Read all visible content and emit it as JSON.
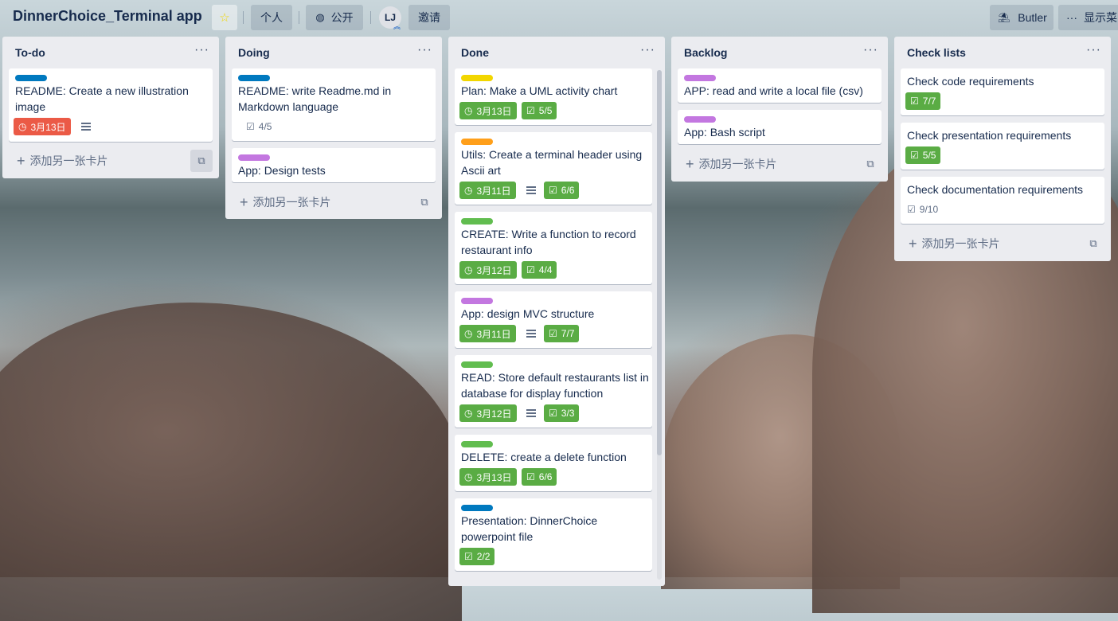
{
  "header": {
    "board_title": "DinnerChoice_Terminal app",
    "personal_label": "个人",
    "visibility_label": "公开",
    "avatar_initials": "LJ",
    "invite_label": "邀请",
    "butler_label": "Butler",
    "show_menu_label": "显示菜"
  },
  "add_card_label": "添加另一张卡片",
  "colors": {
    "label_blue": "#0079bf",
    "label_purple": "#c377e0",
    "label_yellow": "#f2d600",
    "label_orange": "#ff9f1a",
    "label_green": "#61bd4f",
    "badge_green": "#5aac44",
    "badge_red": "#eb5a46"
  },
  "lists": [
    {
      "title": "To-do",
      "cards": [
        {
          "label": "blue",
          "title": "README: Create a new illustration image",
          "due": "3月13日",
          "due_status": "overdue",
          "has_description": true
        }
      ]
    },
    {
      "title": "Doing",
      "cards": [
        {
          "label": "blue",
          "title": "README: write Readme.md in Markdown language",
          "checklist": "4/5"
        },
        {
          "label": "purple",
          "title": "App: Design tests"
        }
      ]
    },
    {
      "title": "Done",
      "cards": [
        {
          "label": "yellow",
          "title": "Plan: Make a UML activity chart",
          "due": "3月13日",
          "checklist": "5/5"
        },
        {
          "label": "orange",
          "title": "Utils: Create a terminal header using Ascii art",
          "due": "3月11日",
          "has_description": true,
          "checklist": "6/6"
        },
        {
          "label": "green",
          "title": "CREATE: Write a function to record restaurant info",
          "due": "3月12日",
          "checklist": "4/4"
        },
        {
          "label": "purple",
          "title": "App: design MVC structure",
          "due": "3月11日",
          "has_description": true,
          "checklist": "7/7"
        },
        {
          "label": "green",
          "title": "READ: Store default restaurants list in database for display function",
          "due": "3月12日",
          "has_description": true,
          "checklist": "3/3"
        },
        {
          "label": "green",
          "title": "DELETE: create a delete function",
          "due": "3月13日",
          "checklist": "6/6"
        },
        {
          "label": "blue",
          "title": "Presentation: DinnerChoice powerpoint file",
          "checklist": "2/2"
        }
      ]
    },
    {
      "title": "Backlog",
      "cards": [
        {
          "label": "purple",
          "title": "APP: read and write a local file (csv)"
        },
        {
          "label": "purple",
          "title": "App: Bash script"
        }
      ]
    },
    {
      "title": "Check lists",
      "cards": [
        {
          "title": "Check code requirements",
          "checklist": "7/7"
        },
        {
          "title": "Check presentation requirements",
          "checklist": "5/5"
        },
        {
          "title": "Check documentation requirements",
          "checklist": "9/10",
          "checklist_status": "incomplete"
        }
      ]
    }
  ]
}
